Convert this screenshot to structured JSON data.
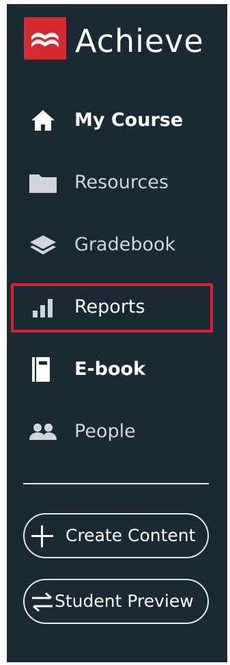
{
  "brand": {
    "name": "Achieve",
    "logo_color": "#d52a32"
  },
  "nav": {
    "items": [
      {
        "label": "My Course",
        "icon": "home-icon"
      },
      {
        "label": "Resources",
        "icon": "folder-icon"
      },
      {
        "label": "Gradebook",
        "icon": "layers-icon"
      },
      {
        "label": "Reports",
        "icon": "bar-chart-icon"
      },
      {
        "label": "E-book",
        "icon": "book-icon"
      },
      {
        "label": "People",
        "icon": "people-icon"
      }
    ]
  },
  "actions": {
    "create_content": "Create Content",
    "student_preview": "Student Preview"
  },
  "colors": {
    "sidebar_bg": "#192a34",
    "highlight": "#e31b2f",
    "text": "#ffffff",
    "muted_text": "#cfd6db"
  }
}
